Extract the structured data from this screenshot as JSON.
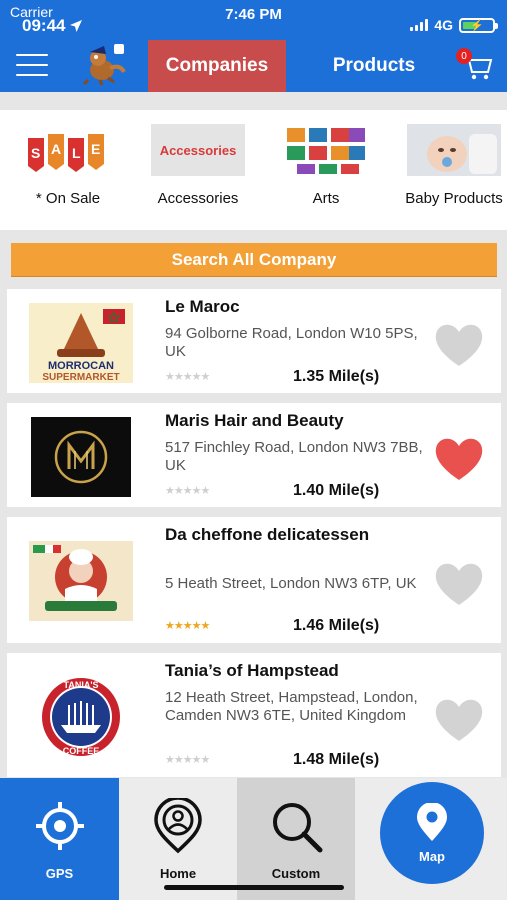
{
  "status": {
    "carrier": "Carrier",
    "time_left": "09:44",
    "time_center": "7:46 PM",
    "network": "4G"
  },
  "nav": {
    "tabs": [
      {
        "label": "Companies",
        "active": true
      },
      {
        "label": "Products",
        "active": false
      }
    ],
    "cart_count": "0"
  },
  "categories": [
    {
      "label": "* On Sale",
      "image_text": "SALE"
    },
    {
      "label": "Accessories",
      "image_text": "Accessories"
    },
    {
      "label": "Arts"
    },
    {
      "label": "Baby Products"
    }
  ],
  "search_button": "Search All Company",
  "companies": [
    {
      "name": "Le Maroc",
      "address": "94 Golborne Road, London W10 5PS, UK",
      "distance": "1.35 Mile(s)",
      "rating": 0,
      "favorite": false,
      "logo_text": [
        "MORROCAN",
        "SUPERMARKET"
      ]
    },
    {
      "name": "Maris Hair and Beauty",
      "address": "517 Finchley Road, London NW3 7BB, UK",
      "distance": "1.40 Mile(s)",
      "rating": 0,
      "favorite": true
    },
    {
      "name": "Da cheffone delicatessen",
      "address": "5 Heath Street, London NW3 6TP, UK",
      "distance": "1.46 Mile(s)",
      "rating": 5,
      "favorite": false
    },
    {
      "name": "Tania’s of Hampstead",
      "address": "12 Heath Street, Hampstead, London, Camden NW3 6TE, United Kingdom",
      "distance": "1.48 Mile(s)",
      "rating": 0,
      "favorite": false,
      "logo_text": [
        "TANIA'S",
        "COFFEE"
      ]
    }
  ],
  "bottom_nav": [
    {
      "label": "GPS",
      "icon": "gps-target-icon"
    },
    {
      "label": "Home",
      "icon": "home-pin-icon"
    },
    {
      "label": "Custom",
      "icon": "search-icon"
    },
    {
      "label": "Map",
      "icon": "map-pin-icon"
    }
  ],
  "colors": {
    "primary": "#1d70d8",
    "active_tab": "#c94c4c",
    "search_button": "#f3a037",
    "heart_active": "#e8514d",
    "heart_inactive": "#d3d3d3",
    "star_gold": "#f0a51e"
  }
}
